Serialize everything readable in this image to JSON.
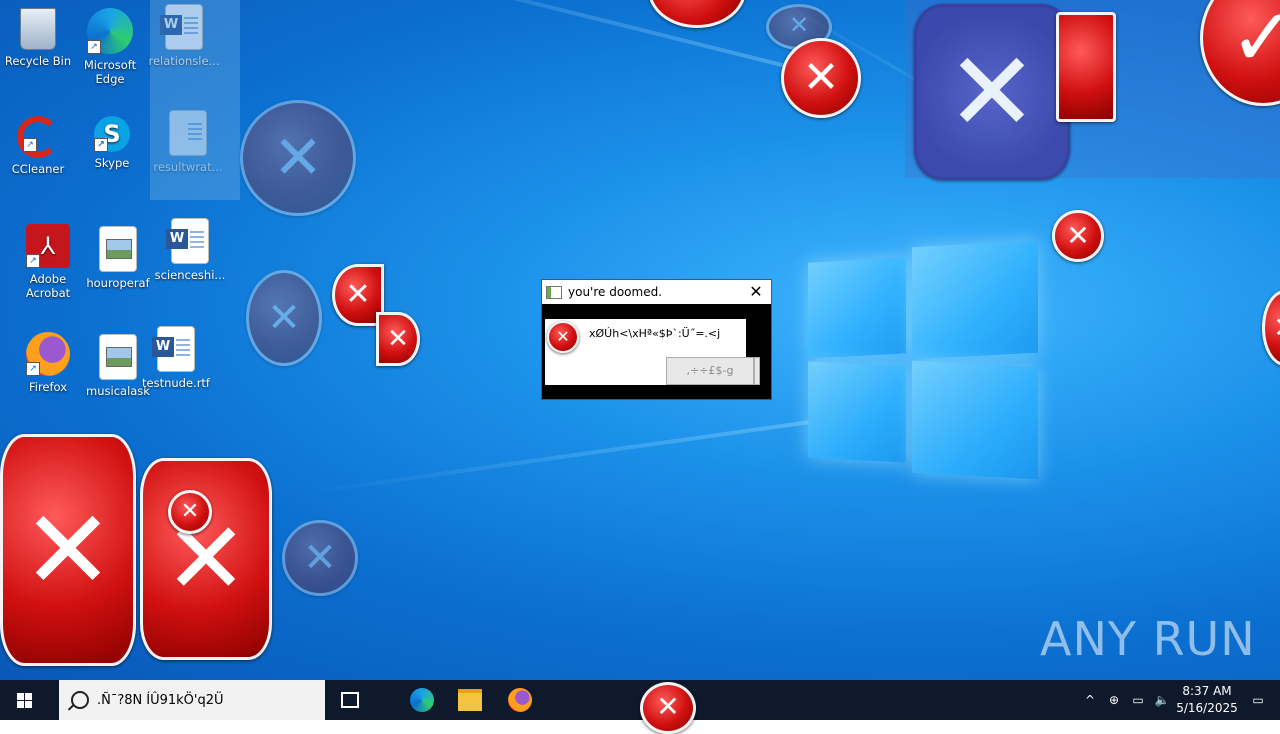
{
  "desktop": {
    "icons": [
      {
        "label": "Recycle Bin",
        "icon": "recycle-bin-icon"
      },
      {
        "label": "Microsoft Edge",
        "icon": "edge-icon"
      },
      {
        "label": "relationsle...",
        "icon": "word-document-icon"
      },
      {
        "label": "CCleaner",
        "icon": "ccleaner-icon"
      },
      {
        "label": "Skype",
        "icon": "skype-icon"
      },
      {
        "label": "resultwrat...",
        "icon": "document-icon"
      },
      {
        "label": "Adobe Acrobat",
        "icon": "acrobat-icon"
      },
      {
        "label": "houroperaf",
        "icon": "image-file-icon"
      },
      {
        "label": "scienceshi...",
        "icon": "word-document-icon"
      },
      {
        "label": "Firefox",
        "icon": "firefox-icon"
      },
      {
        "label": "musicalask",
        "icon": "image-file-icon"
      },
      {
        "label": "testnude.rtf",
        "icon": "word-document-icon"
      }
    ]
  },
  "dialog": {
    "title": "you're doomed.",
    "close_glyph": "✕",
    "message": "xØÚh<\\xHª«$Þ`:Ü˝=.<j",
    "button_label": ",÷÷£$-g"
  },
  "taskbar": {
    "search_text": ".Ñ¯?8N",
    "search_overflow_text": "ÍÛ91kÖ'q2Ü",
    "clock_time": "8:37 AM",
    "clock_date": "5/16/2025"
  },
  "watermark": "ANY RUN",
  "colors": {
    "desktop_blue": "#0b6fd0",
    "taskbar": "#0e1a2b",
    "error_red": "#d01010"
  }
}
